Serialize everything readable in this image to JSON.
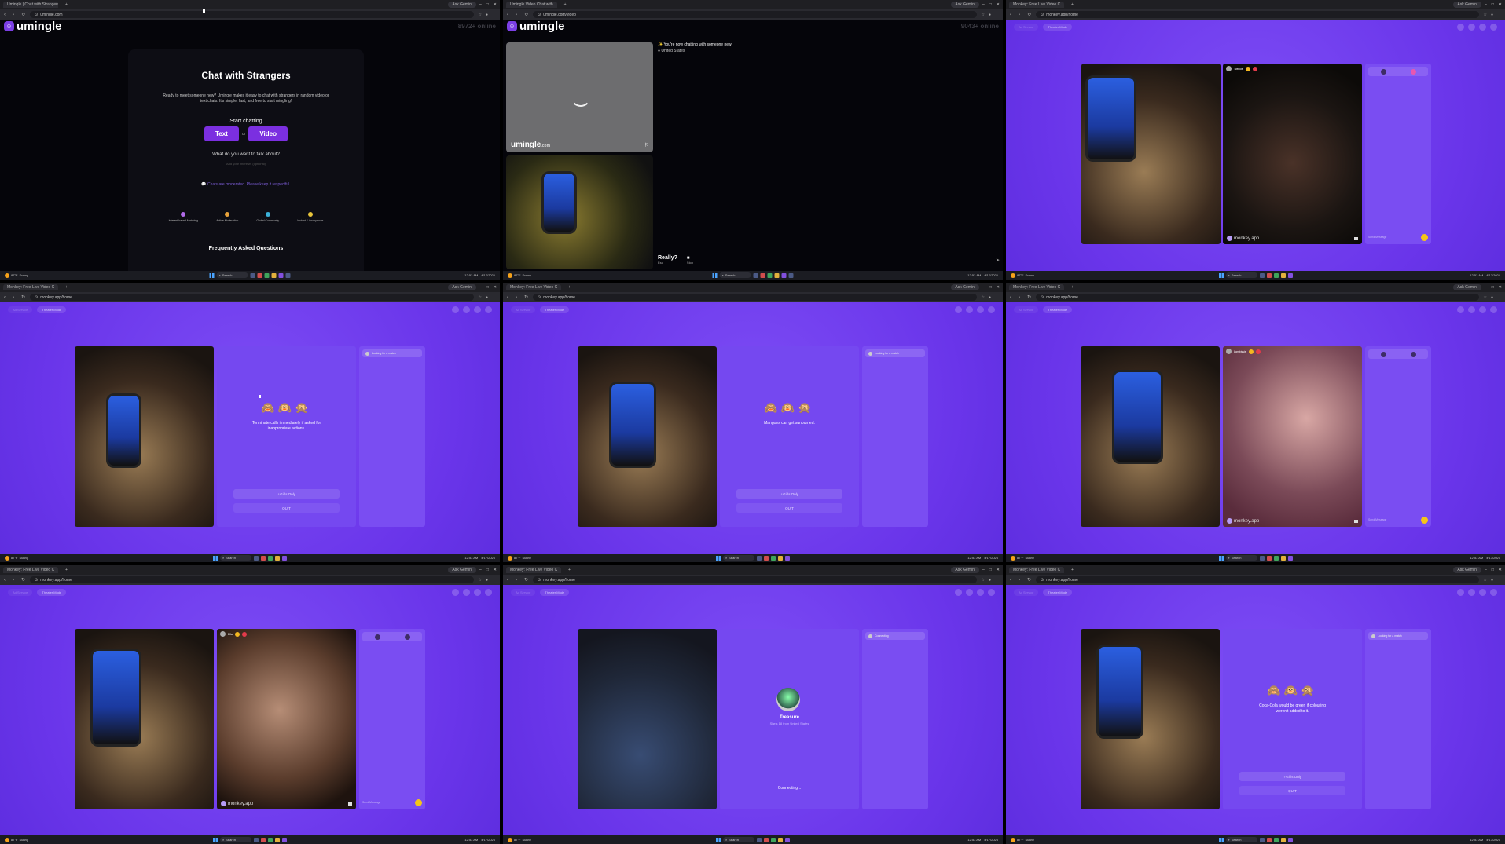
{
  "browser": {
    "tab_umingle_home": "Umingle | Chat with Strangers",
    "tab_umingle_video": "Umingle Video Chat with",
    "tab_monkey": "Monkey: Free Live Video C",
    "ask_gemini": "Ask Gemini",
    "url_umingle_home": "umingle.com",
    "url_umingle_video": "umingle.com/video",
    "url_monkey": "monkey.app/home"
  },
  "taskbar": {
    "temp": "87°F",
    "weather": "Sunny",
    "search": "Search",
    "time": "12:53 AM",
    "date": "4/17/2026"
  },
  "umingle_home": {
    "brand": "umingle",
    "online": "8972+ online",
    "title": "Chat with Strangers",
    "desc": "Ready to meet someone new? Umingle makes it easy to chat with strangers in random video or text chats. It's simple, fast, and free to start mingling!",
    "start_label": "Start chatting",
    "text_btn": "Text",
    "or": "or",
    "video_btn": "Video",
    "talk_label": "What do you want to talk about?",
    "interests_placeholder": "Add your interests (optional)",
    "moderated": "Chats are moderated. Please keep it respectful.",
    "features": [
      "Interest-based Matching",
      "Active Moderation",
      "Global Community",
      "Instant & Anonymous"
    ],
    "faq": "Frequently Asked Questions"
  },
  "umingle_video": {
    "brand": "umingle",
    "brand_suffix": ".com",
    "online": "9043+ online",
    "chat_line": "You're now chatting with someone new",
    "country": "United States",
    "really": "Really?",
    "esc": "Esc",
    "stop": "Stop"
  },
  "monkey": {
    "top_left": "Ad Service",
    "top_theater": "Theater Mode",
    "brand": "monkey.app",
    "girls_only": "Girls Only",
    "quit": "QUIT",
    "waiting": "Looking for a match",
    "send_message": "Send Message",
    "connecting_side": "Connecting",
    "emojis": "🙈🙉🙊",
    "fact1": "Terminate calls immediately if asked for inappropriate actions.",
    "fact2": "Mangoes can get sunburned.",
    "fact3": "Coca-Cola would be green if colouring weren't added to it.",
    "peer_name": "Treasure",
    "peer_sub": "She's 18 from United States",
    "connecting": "Connecting...",
    "peer_label_1": "Twinkle",
    "peer_label_2": "Lambissie",
    "peer_label_3": "Ella"
  }
}
